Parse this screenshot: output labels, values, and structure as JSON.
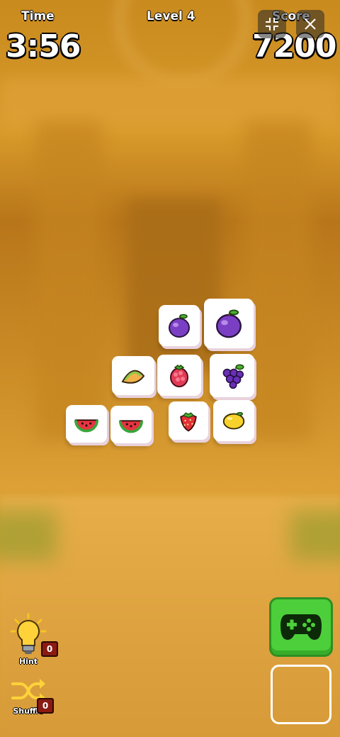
{
  "hud": {
    "time_label": "Time",
    "time_value": "3:56",
    "level_label": "Level 4",
    "score_label": "Score",
    "score_value": "7200"
  },
  "buttons": {
    "minimize_icon": "collapse-icon",
    "close_icon": "close-icon",
    "gamepad_icon": "gamepad-icon"
  },
  "tools": {
    "hint_label": "Hint",
    "hint_count": "0",
    "shuffle_label": "Shuffle",
    "shuffle_count": "0"
  },
  "tiles": [
    {
      "fruit": "plum",
      "layer": "top"
    },
    {
      "fruit": "plum",
      "layer": "top"
    },
    {
      "fruit": "melon",
      "layer": "top"
    },
    {
      "fruit": "raspberry",
      "layer": "top"
    },
    {
      "fruit": "grapes",
      "layer": "top"
    },
    {
      "fruit": "watermelon",
      "layer": "top"
    },
    {
      "fruit": "watermelon",
      "layer": "top"
    },
    {
      "fruit": "strawberry",
      "layer": "top"
    },
    {
      "fruit": "lemon",
      "layer": "top"
    }
  ],
  "colors": {
    "accent_green": "#4ccf3a",
    "badge_red": "#8b1a12"
  }
}
